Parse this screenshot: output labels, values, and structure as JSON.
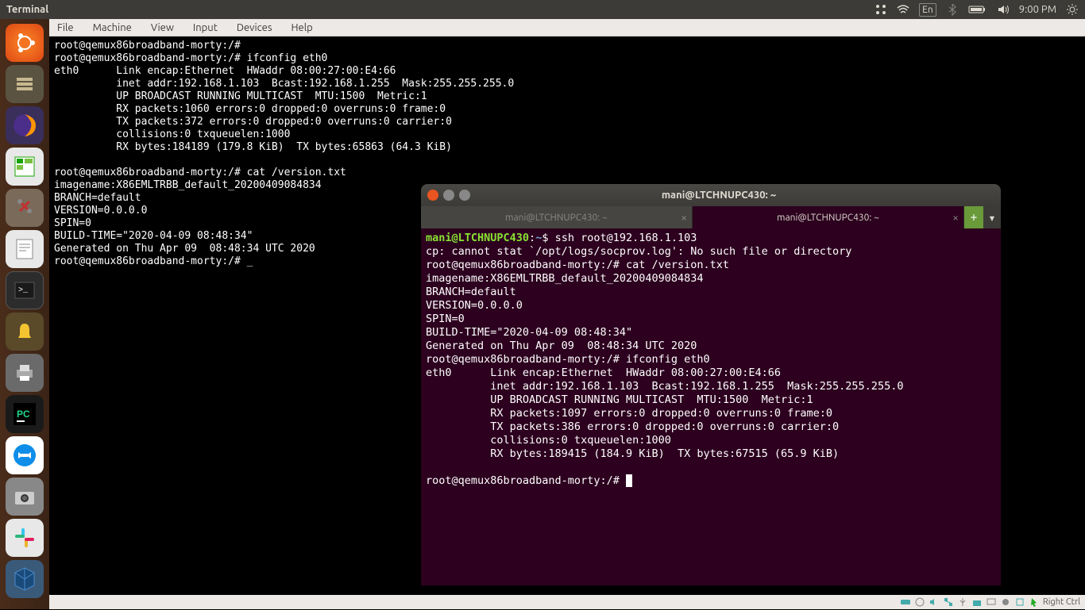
{
  "top_panel": {
    "title": "Terminal",
    "language": "En",
    "time": "9:00 PM"
  },
  "vbox_menu": {
    "file": "File",
    "machine": "Machine",
    "view": "View",
    "input": "Input",
    "devices": "Devices",
    "help": "Help"
  },
  "term1": {
    "lines": [
      "root@qemux86broadband-morty:/#",
      "root@qemux86broadband-morty:/# ifconfig eth0",
      "eth0      Link encap:Ethernet  HWaddr 08:00:27:00:E4:66",
      "          inet addr:192.168.1.103  Bcast:192.168.1.255  Mask:255.255.255.0",
      "          UP BROADCAST RUNNING MULTICAST  MTU:1500  Metric:1",
      "          RX packets:1060 errors:0 dropped:0 overruns:0 frame:0",
      "          TX packets:372 errors:0 dropped:0 overruns:0 carrier:0",
      "          collisions:0 txqueuelen:1000",
      "          RX bytes:184189 (179.8 KiB)  TX bytes:65863 (64.3 KiB)",
      "",
      "root@qemux86broadband-morty:/# cat /version.txt",
      "imagename:X86EMLTRBB_default_20200409084834",
      "BRANCH=default",
      "VERSION=0.0.0.0",
      "SPIN=0",
      "BUILD-TIME=\"2020-04-09 08:48:34\"",
      "Generated on Thu Apr 09  08:48:34 UTC 2020",
      "root@qemux86broadband-morty:/# _"
    ]
  },
  "term2": {
    "window_title": "mani@LTCHNUPC430: ~",
    "tab1": "mani@LTCHNUPC430: ~",
    "tab2": "mani@LTCHNUPC430: ~",
    "prompt_user": "mani@LTCHNUPC430",
    "prompt_path": "~",
    "cmd1": "ssh root@192.168.1.103",
    "line2": "cp: cannot stat `/opt/logs/socprov.log': No such file or directory",
    "line3": "root@qemux86broadband-morty:/# cat /version.txt",
    "line4": "imagename:X86EMLTRBB_default_20200409084834",
    "line5": "BRANCH=default",
    "line6": "VERSION=0.0.0.0",
    "line7": "SPIN=0",
    "line8": "BUILD-TIME=\"2020-04-09 08:48:34\"",
    "line9": "Generated on Thu Apr 09  08:48:34 UTC 2020",
    "line10": "root@qemux86broadband-morty:/# ifconfig eth0",
    "line11": "eth0      Link encap:Ethernet  HWaddr 08:00:27:00:E4:66",
    "line12": "          inet addr:192.168.1.103  Bcast:192.168.1.255  Mask:255.255.255.0",
    "line13": "          UP BROADCAST RUNNING MULTICAST  MTU:1500  Metric:1",
    "line14": "          RX packets:1097 errors:0 dropped:0 overruns:0 frame:0",
    "line15": "          TX packets:386 errors:0 dropped:0 overruns:0 carrier:0",
    "line16": "          collisions:0 txqueuelen:1000",
    "line17": "          RX bytes:189415 (184.9 KiB)  TX bytes:67515 (65.9 KiB)",
    "line18": "",
    "line19": "root@qemux86broadband-morty:/# "
  },
  "status": {
    "host_key": "Right Ctrl"
  },
  "launcher_icons": [
    "ubuntu",
    "files",
    "firefox",
    "calc",
    "settings",
    "writer",
    "terminal",
    "bell",
    "printer",
    "pycharm",
    "teamviewer",
    "camera",
    "slack",
    "vbox"
  ]
}
